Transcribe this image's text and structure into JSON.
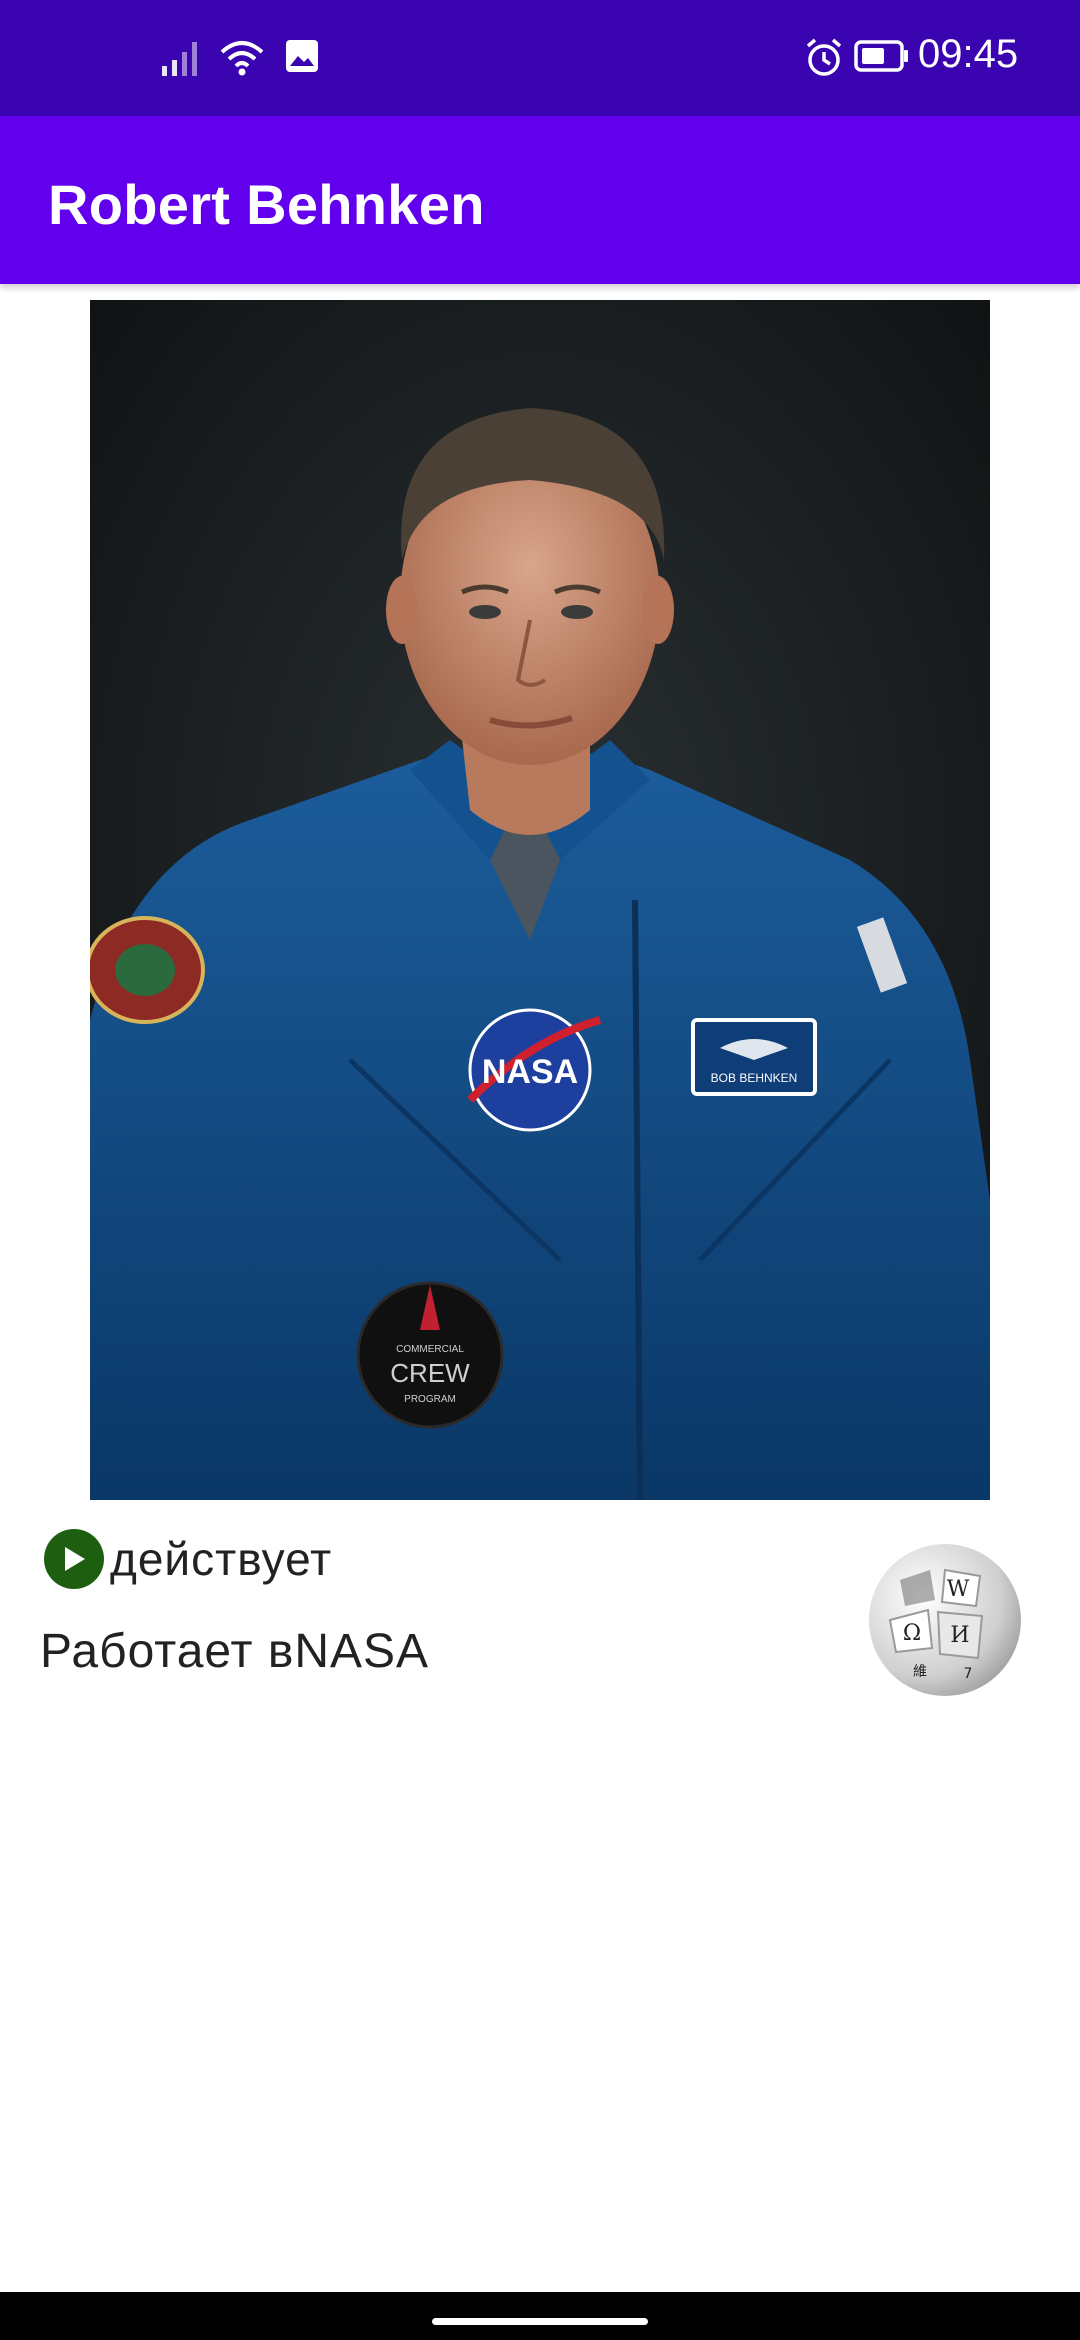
{
  "status_bar": {
    "time": "09:45",
    "icons": [
      "signal-icon",
      "wifi-icon",
      "image-notification-icon",
      "alarm-icon",
      "battery-icon"
    ]
  },
  "app_bar": {
    "title": "Robert Behnken"
  },
  "photo": {
    "description_icon": "astronaut-portrait",
    "patch_nasa": "NASA",
    "name_tag": "BOB BEHNKEN",
    "patch_crew_top": "COMMERCIAL",
    "patch_crew_mid": "CREW",
    "patch_crew_bottom": "PROGRAM"
  },
  "details": {
    "status_icon": "play-icon",
    "status_label": "действует",
    "work_label": "Работает вNASA",
    "wiki_icon": "wikipedia-logo"
  },
  "colors": {
    "status_bar": "#3a05b0",
    "app_bar": "#6200ee",
    "status_icon_bg": "#1e5e10",
    "suit": "#0e4d8a"
  }
}
